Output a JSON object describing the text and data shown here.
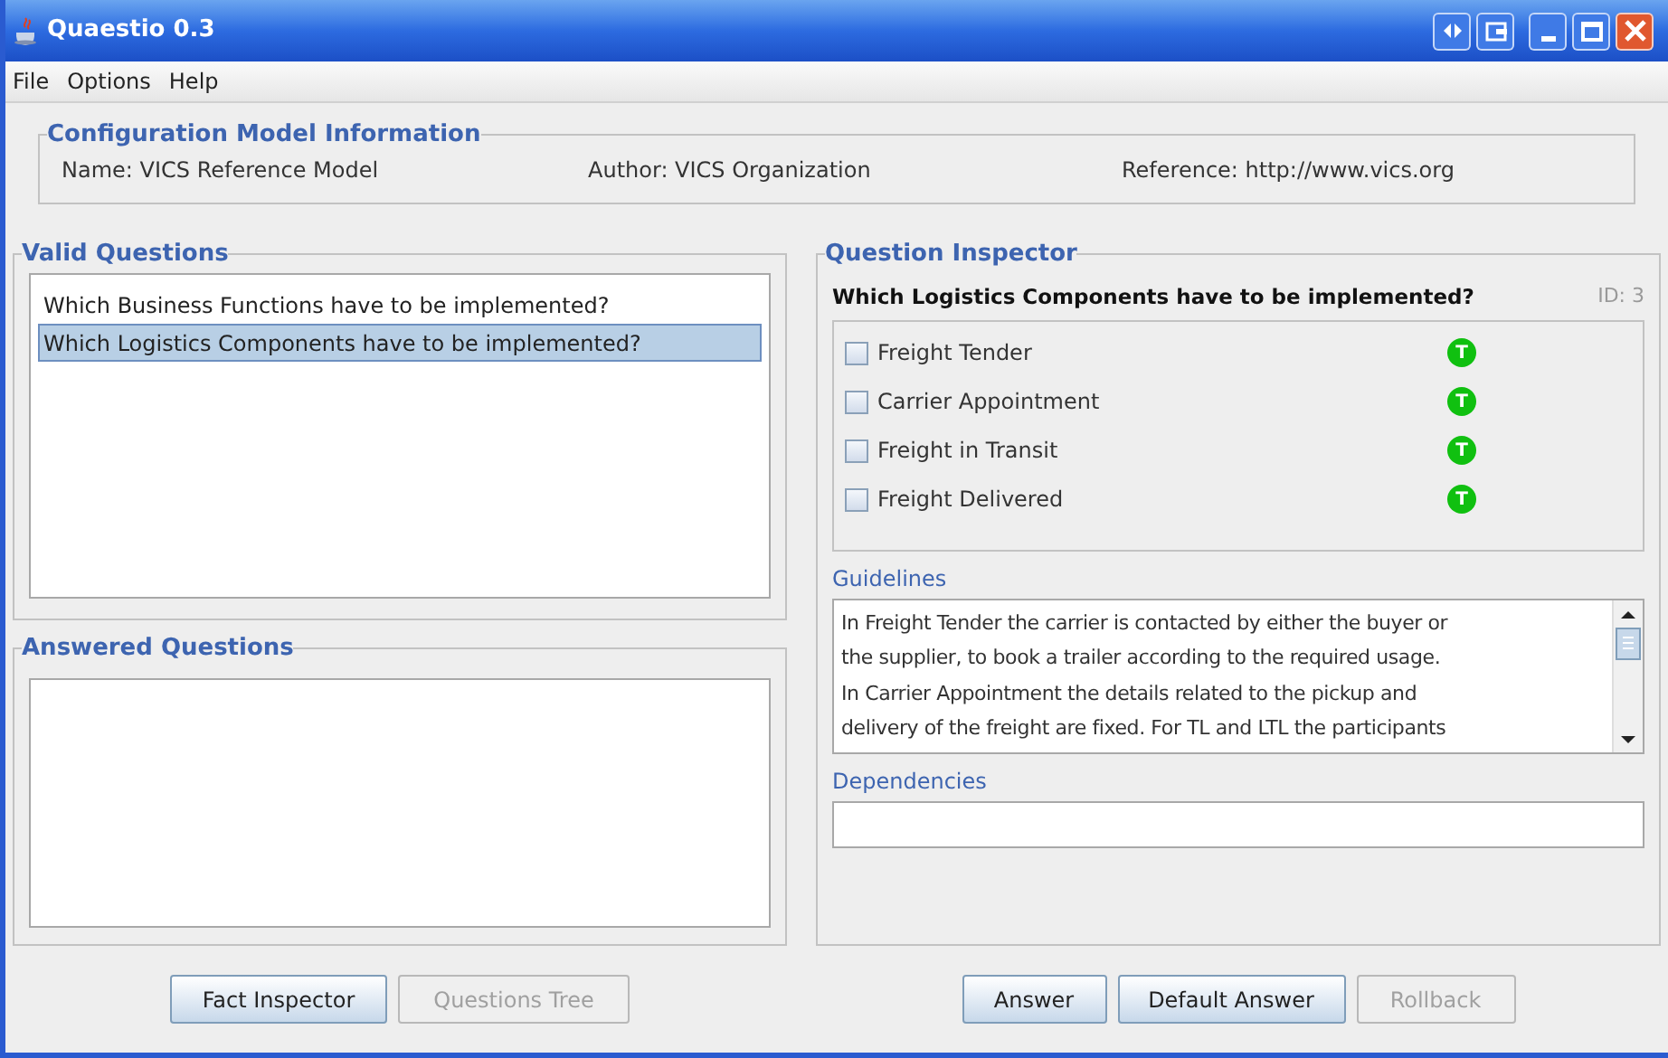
{
  "window": {
    "title": "Quaestio 0.3"
  },
  "menu": [
    "File",
    "Options",
    "Help"
  ],
  "config": {
    "title": "Configuration Model Information",
    "name": "Name: VICS Reference Model",
    "author": "Author: VICS Organization",
    "reference": "Reference: http://www.vics.org"
  },
  "valid_questions": {
    "title": "Valid Questions",
    "items": [
      {
        "text": "Which Business Functions have to be implemented?",
        "selected": false
      },
      {
        "text": "Which Logistics Components have to be implemented?",
        "selected": true
      }
    ]
  },
  "answered_questions": {
    "title": "Answered Questions"
  },
  "inspector": {
    "title": "Question Inspector",
    "question": "Which Logistics Components have to be implemented?",
    "id": "ID: 3",
    "options": [
      {
        "label": "Freight Tender",
        "checked": false,
        "badge": "T"
      },
      {
        "label": "Carrier Appointment",
        "checked": false,
        "badge": "T"
      },
      {
        "label": "Freight in Transit",
        "checked": false,
        "badge": "T"
      },
      {
        "label": "Freight Delivered",
        "checked": false,
        "badge": "T"
      }
    ],
    "guidelines_label": "Guidelines",
    "guidelines": [
      "In Freight Tender the carrier is contacted by either the buyer or",
      "the supplier, to book a trailer according to the required usage.",
      "In Carrier Appointment the details related to the pickup and",
      "delivery of the freight are fixed. For TL and LTL the participants"
    ],
    "dependencies_label": "Dependencies"
  },
  "left_buttons": [
    {
      "label": "Fact Inspector",
      "disabled": false
    },
    {
      "label": "Questions Tree",
      "disabled": true
    }
  ],
  "right_buttons": [
    {
      "label": "Answer",
      "disabled": false
    },
    {
      "label": "Default Answer",
      "disabled": false
    },
    {
      "label": "Rollback",
      "disabled": true
    }
  ]
}
